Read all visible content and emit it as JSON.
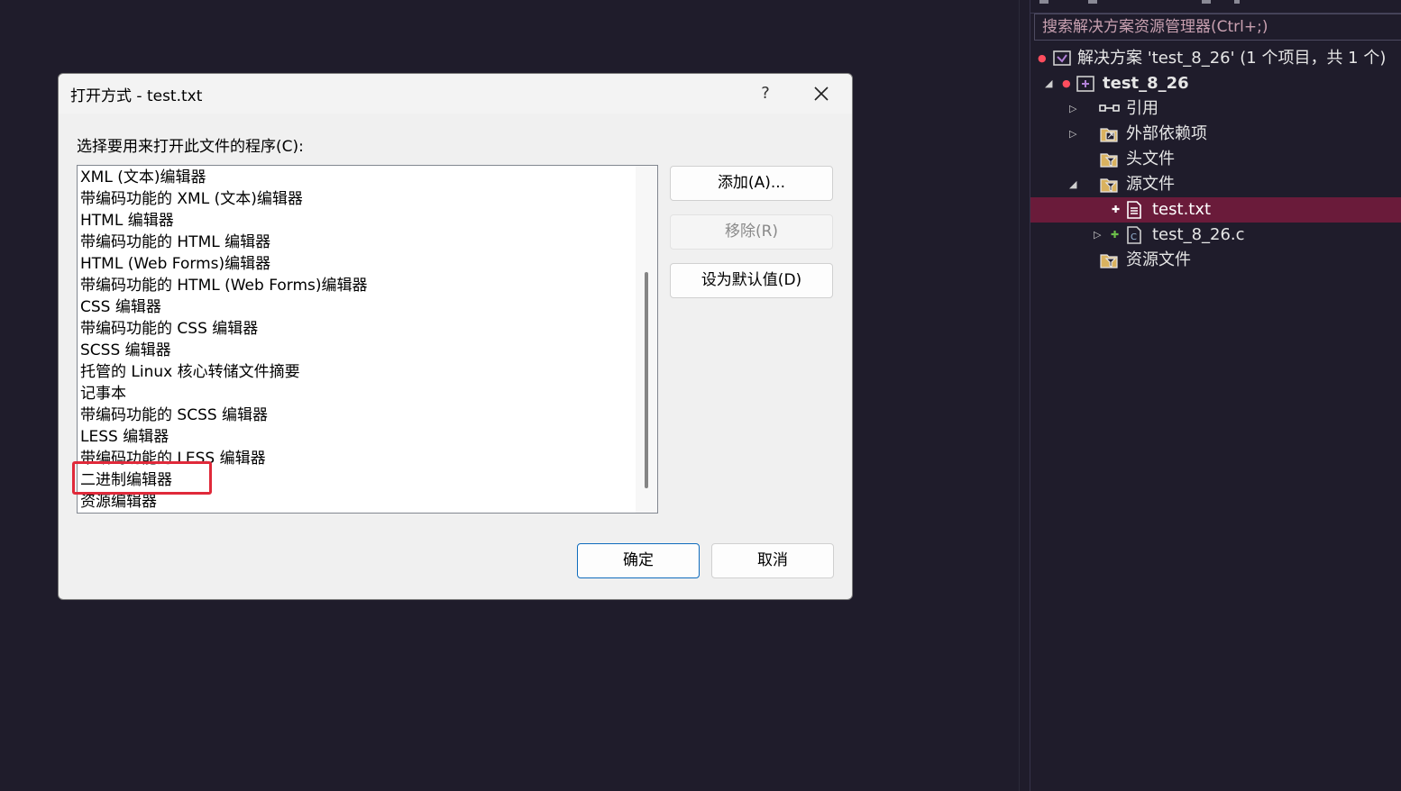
{
  "dialog": {
    "title": "打开方式 - test.txt",
    "help": "?",
    "prompt": "选择要用来打开此文件的程序(C):",
    "programs": [
      "XML (文本)编辑器",
      "带编码功能的 XML (文本)编辑器",
      "HTML 编辑器",
      "带编码功能的 HTML 编辑器",
      "HTML (Web Forms)编辑器",
      "带编码功能的 HTML (Web Forms)编辑器",
      "CSS 编辑器",
      "带编码功能的 CSS 编辑器",
      "SCSS 编辑器",
      "托管的 Linux 核心转储文件摘要",
      "记事本",
      "带编码功能的 SCSS 编辑器",
      "LESS 编辑器",
      "带编码功能的 LESS 编辑器",
      "二进制编辑器",
      "资源编辑器"
    ],
    "buttons": {
      "add": "添加(A)...",
      "remove": "移除(R)",
      "set_default": "设为默认值(D)",
      "ok": "确定",
      "cancel": "取消"
    }
  },
  "explorer": {
    "search_placeholder": "搜索解决方案资源管理器(Ctrl+;)",
    "solution": "解决方案 'test_8_26' (1 个项目，共 1 个)",
    "project": "test_8_26",
    "references": "引用",
    "external_deps": "外部依赖项",
    "header_files": "头文件",
    "source_files": "源文件",
    "file_txt": "test.txt",
    "file_c": "test_8_26.c",
    "resource_files": "资源文件"
  },
  "colors": {
    "background": "#1f1c2b",
    "selection": "#6a1b3a",
    "highlight": "#e0293a",
    "primary_border": "#0f6cbd"
  }
}
